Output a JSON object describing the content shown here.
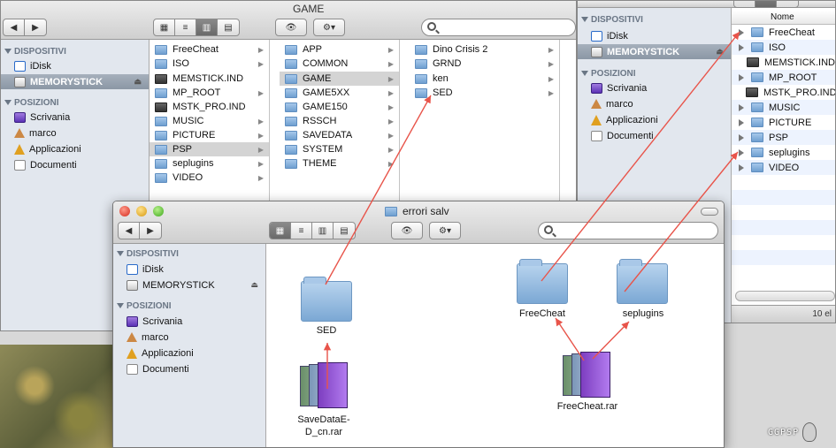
{
  "window_back_left": {
    "title": "GAME",
    "sidebar": {
      "devices_header": "DISPOSITIVI",
      "devices": [
        "iDisk",
        "MEMORYSTICK"
      ],
      "places_header": "POSIZIONI",
      "places": [
        "Scrivania",
        "marco",
        "Applicazioni",
        "Documenti"
      ]
    },
    "col1": [
      "FreeCheat",
      "ISO",
      "MEMSTICK.IND",
      "MP_ROOT",
      "MSTK_PRO.IND",
      "MUSIC",
      "PICTURE",
      "PSP",
      "seplugins",
      "VIDEO"
    ],
    "col2": [
      "APP",
      "COMMON",
      "GAME",
      "GAME5XX",
      "GAME150",
      "RSSCH",
      "SAVEDATA",
      "SYSTEM",
      "THEME"
    ],
    "col3": [
      "Dino Crisis 2",
      "GRND",
      "ken",
      "SED"
    ]
  },
  "window_back_right": {
    "sidebar": {
      "devices_header": "DISPOSITIVI",
      "devices": [
        "iDisk",
        "MEMORYSTICK"
      ],
      "places_header": "POSIZIONI",
      "places": [
        "Scrivania",
        "marco",
        "Applicazioni",
        "Documenti"
      ]
    },
    "list_header": "Nome",
    "rows": [
      "FreeCheat",
      "ISO",
      "MEMSTICK.IND",
      "MP_ROOT",
      "MSTK_PRO.IND",
      "MUSIC",
      "PICTURE",
      "PSP",
      "seplugins",
      "VIDEO"
    ],
    "status": "10 el"
  },
  "window_front": {
    "title": "errori salv",
    "sidebar": {
      "devices_header": "DISPOSITIVI",
      "devices": [
        "iDisk",
        "MEMORYSTICK"
      ],
      "places_header": "POSIZIONI",
      "places": [
        "Scrivania",
        "marco",
        "Applicazioni",
        "Documenti"
      ]
    },
    "items": [
      {
        "name": "SED",
        "kind": "folder"
      },
      {
        "name": "FreeCheat",
        "kind": "folder"
      },
      {
        "name": "seplugins",
        "kind": "folder"
      },
      {
        "name": "SaveDataE-D_cn.rar",
        "line1": "SaveDataE-",
        "line2": "D_cn.rar",
        "kind": "archive"
      },
      {
        "name": "FreeCheat.rar",
        "kind": "archive"
      }
    ]
  },
  "watermark": "GGPSP",
  "annotation_color": "#e8544a"
}
